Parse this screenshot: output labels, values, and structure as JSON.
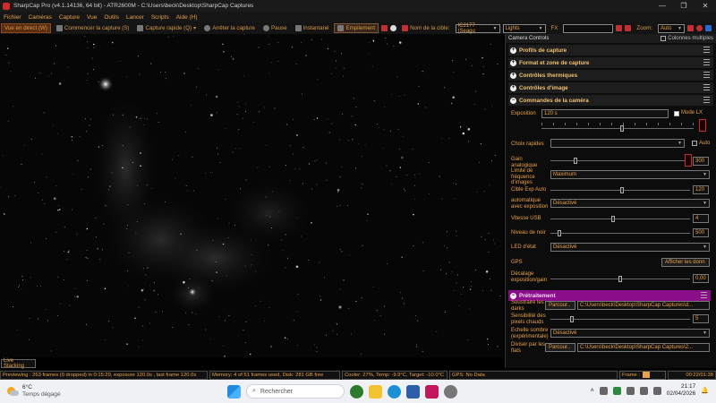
{
  "window": {
    "title": "SharpCap Pro (v4.1.14136, 64 bit) - ATR2600M - C:\\Users\\beck\\Desktop\\SharpCap Captures"
  },
  "menu": [
    "Fichier",
    "Caméras",
    "Capture",
    "Vue",
    "Outils",
    "Lancer",
    "Scripts",
    "Aide (H)"
  ],
  "toolbar": {
    "live": "Vue en direct (W)",
    "start_capture": "Commencer la capture (S)",
    "quick_capture": "Capture rapide (Q)",
    "stop_capture": "Arrêter la capture",
    "pause": "Pause",
    "snapshot": "Instantané",
    "dock": "Empilement",
    "target_label": "Nom de la cible:",
    "target_value": "IC2177 (Seagu",
    "frame_type": "Lights",
    "fx_label": "FX",
    "zoom_label": "Zoom:",
    "zoom_value": "Auto"
  },
  "panel": {
    "header": "Camera Controls",
    "multiple_columns": "Colonnes multiples",
    "sections": {
      "profiles": "Profils de capture",
      "format": "Format et zone de capture",
      "thermal": "Contrôles thermiques",
      "image": "Contrôles d'image",
      "camera": "Commandes de la caméra",
      "preprocessing": "Prétraitement"
    },
    "exposure": {
      "label": "Exposition",
      "value": "120 s",
      "lx_label": "Mode LX"
    },
    "quick_choices": {
      "label": "Choix rapides",
      "auto_label": "Auto"
    },
    "gain": {
      "label": "Gain analogique",
      "value": "300"
    },
    "frame_rate_limit": {
      "label": "Limite de fréquence d'images",
      "value": "Maximum"
    },
    "target_auto_exp": {
      "label": "Cible Exp Auto",
      "value": "120"
    },
    "auto_exposure": {
      "label": "automatique avec exposition",
      "value": "Désactivé"
    },
    "usb_speed": {
      "label": "Vitesse USB",
      "value": "4"
    },
    "black_level": {
      "label": "Niveau de noir",
      "value": "500"
    },
    "test_led": {
      "label": "LED d'état",
      "value": "Désactivé"
    },
    "gps": {
      "label": "GPS",
      "button": "Afficher les donn"
    },
    "exposure_offset": {
      "label": "Décalage exposition/gain",
      "value": "0,00"
    },
    "subtract_darks": {
      "label": "Soustraire les darks",
      "browse": "Parcour..",
      "path": "C:\\Users\\beck\\Desktop\\SharpCap Captures\\d..."
    },
    "hot_pixel": {
      "label": "Sensibilité des pixels chauds",
      "value": "5"
    },
    "dark_scale": {
      "label": "Echelle sombre (expérimentale)",
      "value": "Désactivé"
    },
    "divide_flats": {
      "label": "Diviser par les flats",
      "browse": "Parcour..",
      "path": "C:\\Users\\beck\\Desktop\\SharpCap Captures\\2..."
    }
  },
  "live_stacking": "Live Stacking",
  "status": {
    "preview": "Previewing : 263 frames (0 dropped) in 0:15:29, exposure 120.0s , last frame 120.0s",
    "memory": "Memory: 4 of 51 frames used, Disk: 281 GB free",
    "cooler": "Cooler: 27%, Temp: -9.9°C, Target: -10.0°C",
    "gps": "GPS: No Data",
    "frame_label": "Frame :",
    "elapsed": "00:22/01:38"
  },
  "taskbar": {
    "temp": "6°C",
    "weather": "Temps dégagé",
    "search_placeholder": "Rechercher",
    "time": "21:17",
    "date": "02/04/2026"
  },
  "colors": {
    "accent": "#e8a04a",
    "purple_section": "#8a0e8a",
    "background": "#000000"
  }
}
